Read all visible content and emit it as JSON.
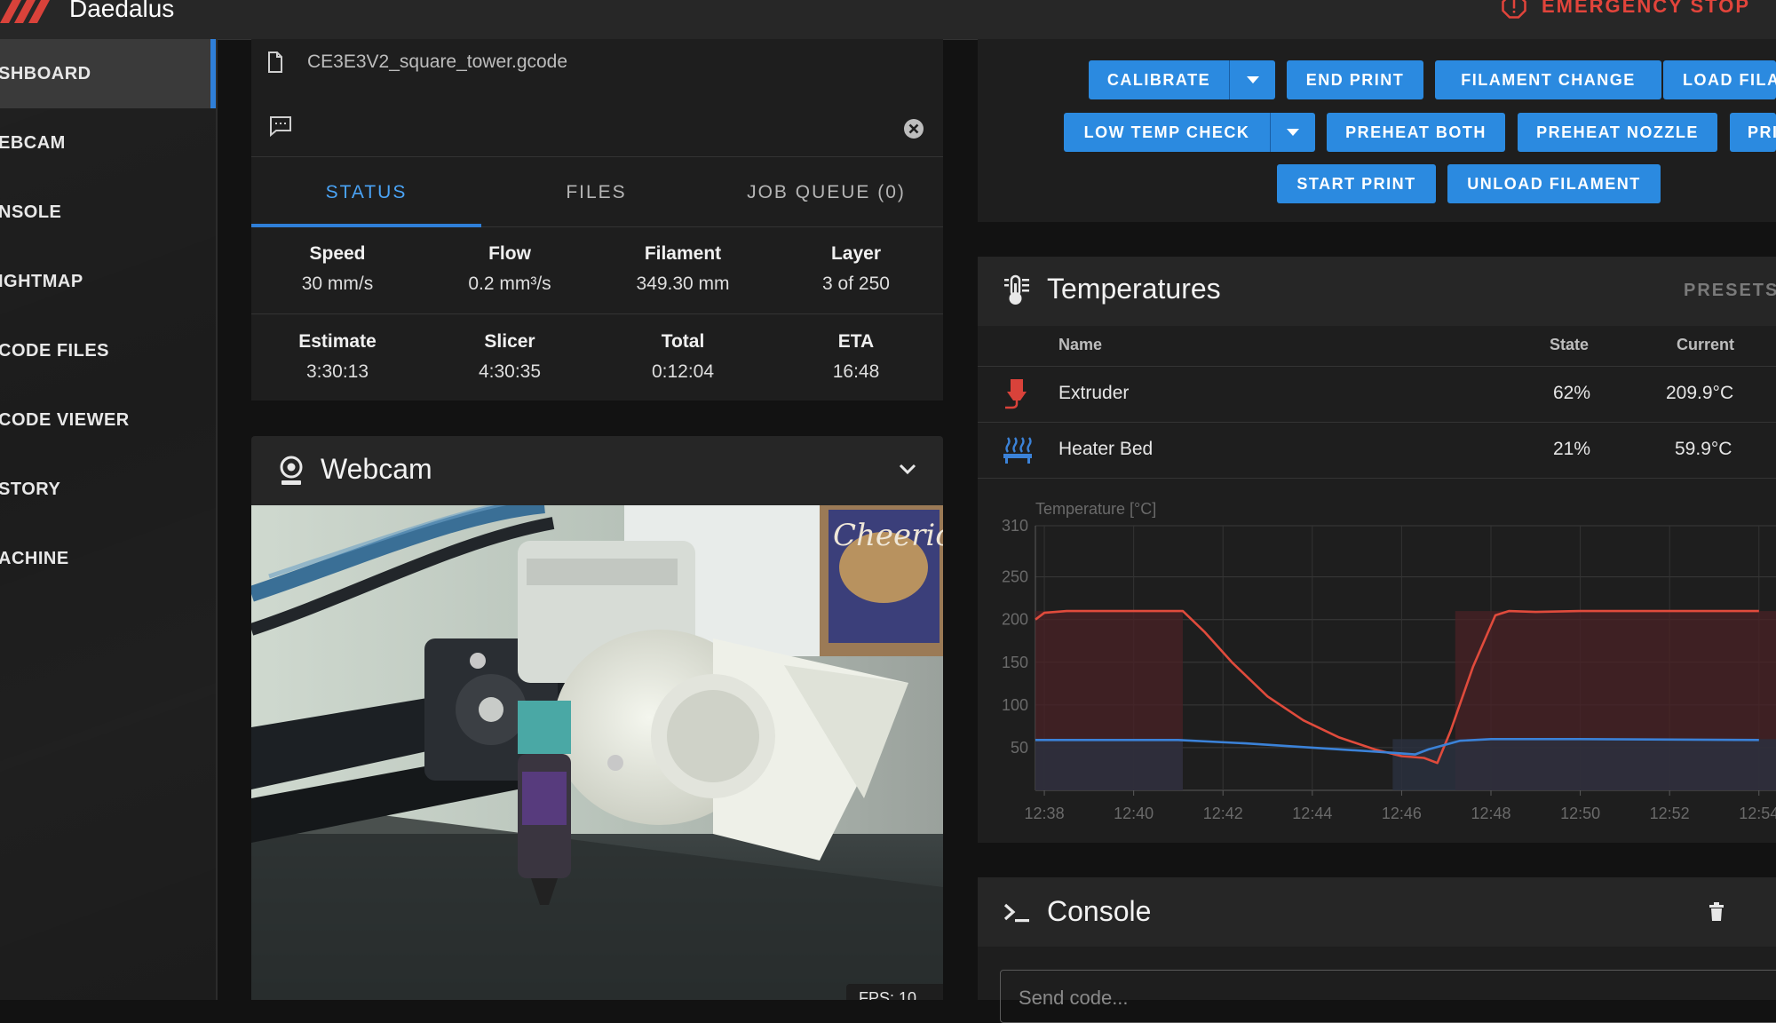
{
  "app": {
    "title": "Daedalus",
    "emergency_stop": "EMERGENCY STOP"
  },
  "sidebar": {
    "items": [
      {
        "label": "SHBOARD",
        "active": true
      },
      {
        "label": "EBCAM"
      },
      {
        "label": "NSOLE"
      },
      {
        "label": "IGHTMAP"
      },
      {
        "label": "CODE FILES"
      },
      {
        "label": "CODE VIEWER"
      },
      {
        "label": "STORY"
      },
      {
        "label": "ACHINE"
      }
    ]
  },
  "job": {
    "filename": "CE3E3V2_square_tower.gcode",
    "tabs": [
      "STATUS",
      "FILES",
      "JOB QUEUE (0)"
    ],
    "stats_row1": [
      {
        "label": "Speed",
        "value": "30 mm/s"
      },
      {
        "label": "Flow",
        "value": "0.2 mm³/s"
      },
      {
        "label": "Filament",
        "value": "349.30 mm"
      },
      {
        "label": "Layer",
        "value": "3 of 250"
      }
    ],
    "stats_row2": [
      {
        "label": "Estimate",
        "value": "3:30:13"
      },
      {
        "label": "Slicer",
        "value": "4:30:35"
      },
      {
        "label": "Total",
        "value": "0:12:04"
      },
      {
        "label": "ETA",
        "value": "16:48"
      }
    ]
  },
  "webcam": {
    "title": "Webcam",
    "fps": "FPS: 10"
  },
  "macros": {
    "row1": [
      "CALIBRATE",
      "END PRINT",
      "FILAMENT CHANGE",
      "LOAD FILA"
    ],
    "row2": [
      "LOW TEMP CHECK",
      "PREHEAT BOTH",
      "PREHEAT NOZZLE",
      "PRI"
    ],
    "row3": [
      "START PRINT",
      "UNLOAD FILAMENT"
    ]
  },
  "temperatures": {
    "title": "Temperatures",
    "presets_label": "PRESETS",
    "columns": [
      "Name",
      "State",
      "Current"
    ],
    "rows": [
      {
        "name": "Extruder",
        "state": "62%",
        "current": "209.9°C"
      },
      {
        "name": "Heater Bed",
        "state": "21%",
        "current": "59.9°C"
      }
    ]
  },
  "chart_data": {
    "type": "line",
    "ylabel": "Temperature [°C]",
    "yticks": [
      50,
      100,
      150,
      200,
      250,
      310
    ],
    "ylim": [
      0,
      310
    ],
    "x_ticks": [
      "12:38",
      "12:40",
      "12:42",
      "12:44",
      "12:46",
      "12:48",
      "12:50",
      "12:52",
      "12:54"
    ],
    "xlim_minutes": [
      37.8,
      54.0
    ],
    "colors": {
      "extruder": "#e04b3c",
      "bed": "#3b82d8",
      "extruder_power": "#4a2226",
      "bed_power": "#2a3140"
    },
    "series": [
      {
        "name": "Extruder",
        "points": [
          [
            37.8,
            200
          ],
          [
            38.0,
            208
          ],
          [
            38.5,
            210
          ],
          [
            39.0,
            210
          ],
          [
            41.0,
            210
          ],
          [
            41.1,
            210
          ],
          [
            41.6,
            185
          ],
          [
            42.2,
            150
          ],
          [
            43.0,
            110
          ],
          [
            43.8,
            82
          ],
          [
            44.6,
            62
          ],
          [
            45.4,
            48
          ],
          [
            46.0,
            40
          ],
          [
            46.5,
            38
          ],
          [
            46.8,
            32
          ],
          [
            47.1,
            70
          ],
          [
            47.6,
            145
          ],
          [
            48.1,
            205
          ],
          [
            48.4,
            210
          ],
          [
            49.0,
            209
          ],
          [
            50.0,
            210
          ],
          [
            54.0,
            210
          ]
        ]
      },
      {
        "name": "Heater Bed",
        "points": [
          [
            37.8,
            59
          ],
          [
            40.0,
            59
          ],
          [
            41.0,
            59
          ],
          [
            42.5,
            55
          ],
          [
            44.0,
            50
          ],
          [
            45.5,
            45
          ],
          [
            46.3,
            42
          ],
          [
            46.6,
            48
          ],
          [
            47.3,
            58
          ],
          [
            48.0,
            60
          ],
          [
            50.0,
            60
          ],
          [
            54.0,
            59
          ]
        ]
      }
    ]
  },
  "console": {
    "title": "Console",
    "placeholder": "Send code..."
  }
}
